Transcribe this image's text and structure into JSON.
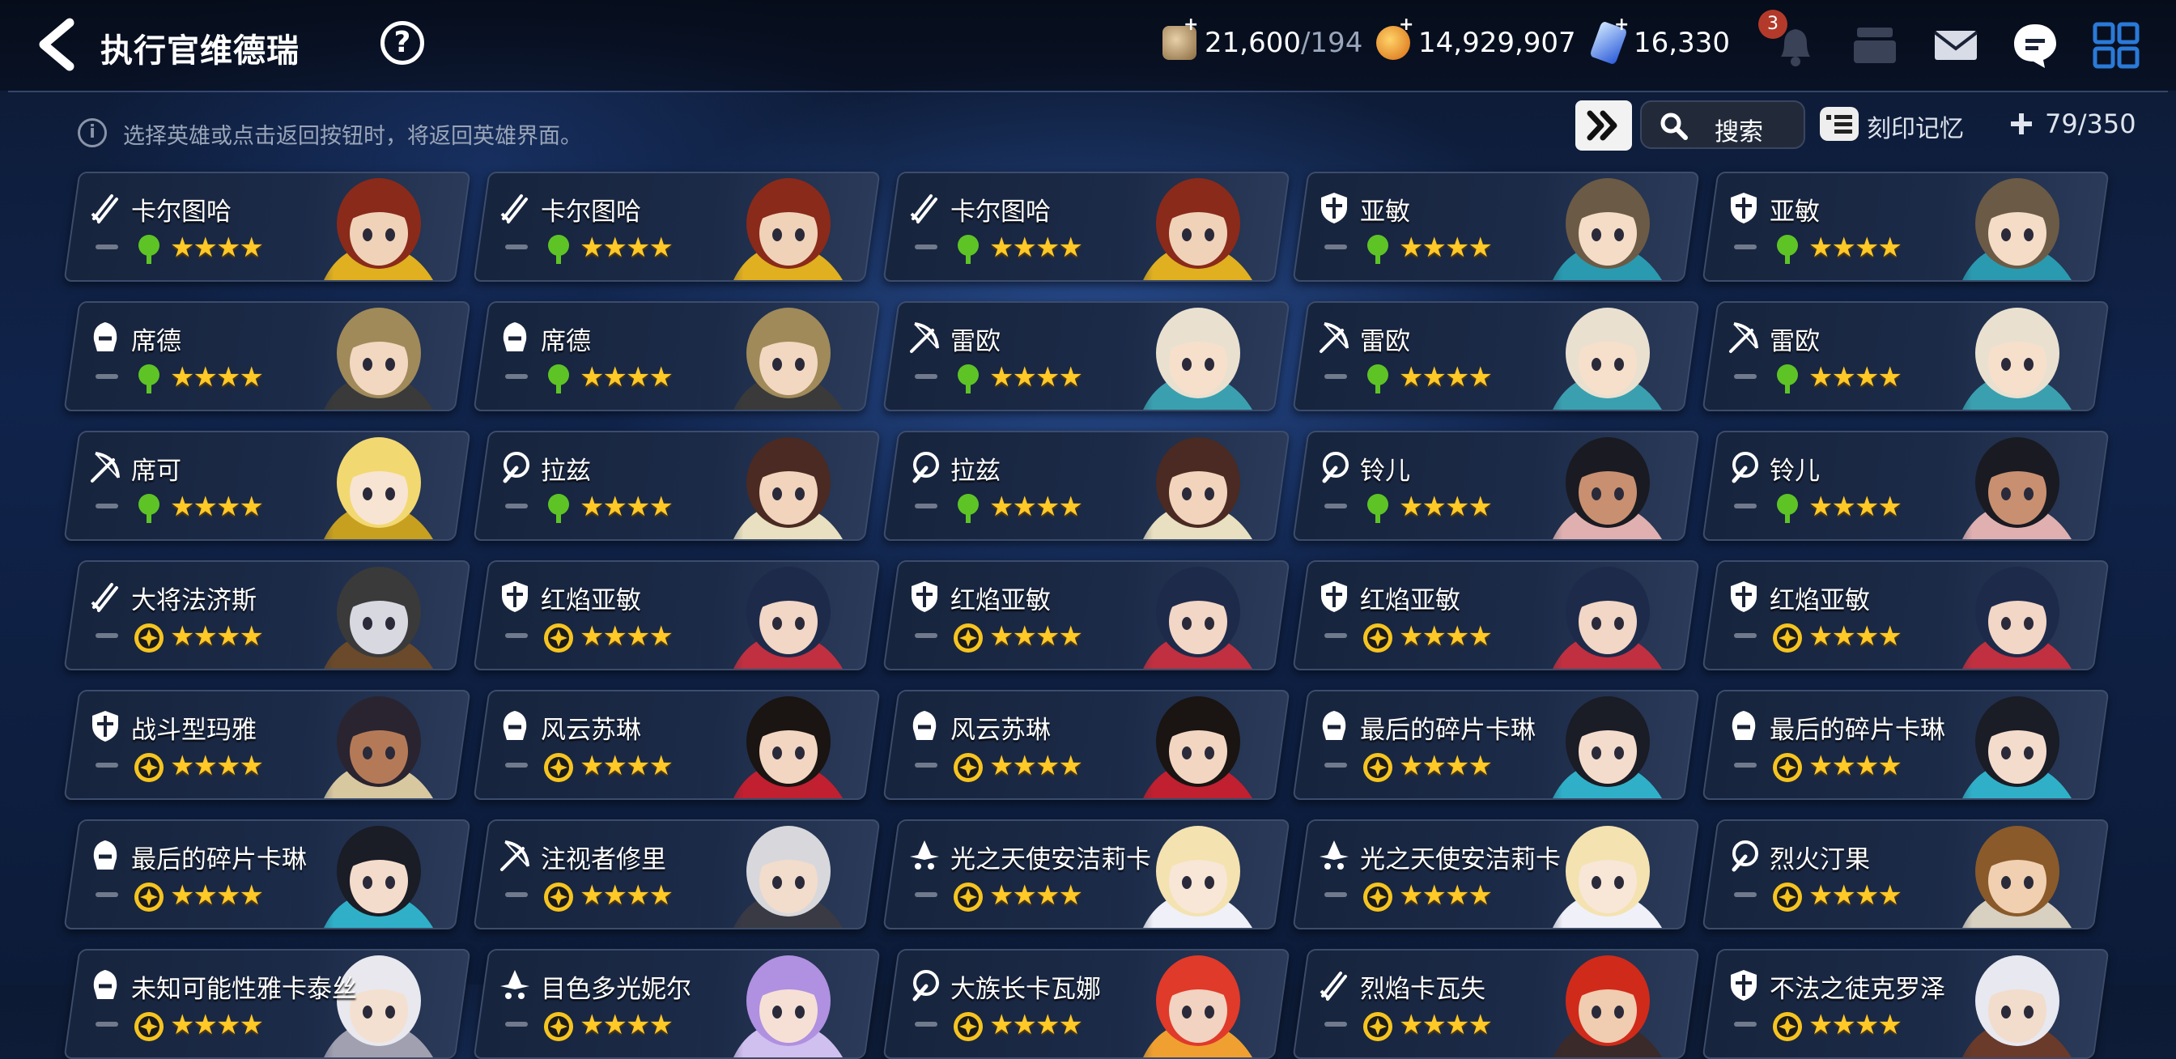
{
  "header": {
    "title": "执行官维德瑞",
    "stamina": "21,600",
    "stamina_cap": "/194",
    "gold": "14,929,907",
    "crystal": "16,330",
    "notification_count": "3"
  },
  "toolbar": {
    "hint": "选择英雄或点击返回按钮时，将返回英雄界面。",
    "search_label": "搜索",
    "imprint_label": "刻印记忆",
    "hero_count": "79/350"
  },
  "heroes": [
    {
      "name": "卡尔图哈",
      "class": "warrior",
      "attr": "earth",
      "stars": 4,
      "hair": "#8a2a1a",
      "skin": "#f0d2b8",
      "accent": "#e0b020"
    },
    {
      "name": "卡尔图哈",
      "class": "warrior",
      "attr": "earth",
      "stars": 4,
      "hair": "#8a2a1a",
      "skin": "#f0d2b8",
      "accent": "#e0b020"
    },
    {
      "name": "卡尔图哈",
      "class": "warrior",
      "attr": "earth",
      "stars": 4,
      "hair": "#8a2a1a",
      "skin": "#f0d2b8",
      "accent": "#e0b020"
    },
    {
      "name": "亚敏",
      "class": "knight",
      "attr": "earth",
      "stars": 4,
      "hair": "#6b5a45",
      "skin": "#f4dcc6",
      "accent": "#2a9ab0"
    },
    {
      "name": "亚敏",
      "class": "knight",
      "attr": "earth",
      "stars": 4,
      "hair": "#6b5a45",
      "skin": "#f4dcc6",
      "accent": "#2a9ab0"
    },
    {
      "name": "席德",
      "class": "thief",
      "attr": "earth",
      "stars": 4,
      "hair": "#a08a5a",
      "skin": "#f2d8c0",
      "accent": "#3a3a3a"
    },
    {
      "name": "席德",
      "class": "thief",
      "attr": "earth",
      "stars": 4,
      "hair": "#a08a5a",
      "skin": "#f2d8c0",
      "accent": "#3a3a3a"
    },
    {
      "name": "雷欧",
      "class": "ranger",
      "attr": "earth",
      "stars": 4,
      "hair": "#eae0d0",
      "skin": "#f6e0cc",
      "accent": "#3aa0b0"
    },
    {
      "name": "雷欧",
      "class": "ranger",
      "attr": "earth",
      "stars": 4,
      "hair": "#eae0d0",
      "skin": "#f6e0cc",
      "accent": "#3aa0b0"
    },
    {
      "name": "雷欧",
      "class": "ranger",
      "attr": "earth",
      "stars": 4,
      "hair": "#eae0d0",
      "skin": "#f6e0cc",
      "accent": "#3aa0b0"
    },
    {
      "name": "席可",
      "class": "ranger",
      "attr": "earth",
      "stars": 4,
      "hair": "#f2d870",
      "skin": "#f8e4d2",
      "accent": "#c8a020"
    },
    {
      "name": "拉兹",
      "class": "mage",
      "attr": "earth",
      "stars": 4,
      "hair": "#4a2a22",
      "skin": "#f2d4bc",
      "accent": "#e8e0c0"
    },
    {
      "name": "拉兹",
      "class": "mage",
      "attr": "earth",
      "stars": 4,
      "hair": "#4a2a22",
      "skin": "#f2d4bc",
      "accent": "#e8e0c0"
    },
    {
      "name": "铃儿",
      "class": "mage",
      "attr": "earth",
      "stars": 4,
      "hair": "#1a1a22",
      "skin": "#c89070",
      "accent": "#e0b0b0"
    },
    {
      "name": "铃儿",
      "class": "mage",
      "attr": "earth",
      "stars": 4,
      "hair": "#1a1a22",
      "skin": "#c89070",
      "accent": "#e0b0b0"
    },
    {
      "name": "大将法济斯",
      "class": "warrior",
      "attr": "light",
      "stars": 4,
      "hair": "#3a3a3a",
      "skin": "#d8d8e0",
      "accent": "#6a4a2a"
    },
    {
      "name": "红焰亚敏",
      "class": "knight",
      "attr": "light",
      "stars": 4,
      "hair": "#1e2a4a",
      "skin": "#f2d6c6",
      "accent": "#c03040"
    },
    {
      "name": "红焰亚敏",
      "class": "knight",
      "attr": "light",
      "stars": 4,
      "hair": "#1e2a4a",
      "skin": "#f2d6c6",
      "accent": "#c03040"
    },
    {
      "name": "红焰亚敏",
      "class": "knight",
      "attr": "light",
      "stars": 4,
      "hair": "#1e2a4a",
      "skin": "#f2d6c6",
      "accent": "#c03040"
    },
    {
      "name": "红焰亚敏",
      "class": "knight",
      "attr": "light",
      "stars": 4,
      "hair": "#1e2a4a",
      "skin": "#f2d6c6",
      "accent": "#c03040"
    },
    {
      "name": "战斗型玛雅",
      "class": "knight",
      "attr": "light",
      "stars": 4,
      "hair": "#2a2430",
      "skin": "#b47a58",
      "accent": "#d8c8a0"
    },
    {
      "name": "风云苏琳",
      "class": "thief",
      "attr": "light",
      "stars": 4,
      "hair": "#1a1412",
      "skin": "#f2d6c2",
      "accent": "#c02030"
    },
    {
      "name": "风云苏琳",
      "class": "thief",
      "attr": "light",
      "stars": 4,
      "hair": "#1a1412",
      "skin": "#f2d6c2",
      "accent": "#c02030"
    },
    {
      "name": "最后的碎片卡琳",
      "class": "thief",
      "attr": "light",
      "stars": 4,
      "hair": "#1a1c26",
      "skin": "#f4dccc",
      "accent": "#30b0c8"
    },
    {
      "name": "最后的碎片卡琳",
      "class": "thief",
      "attr": "light",
      "stars": 4,
      "hair": "#1a1c26",
      "skin": "#f4dccc",
      "accent": "#30b0c8"
    },
    {
      "name": "最后的碎片卡琳",
      "class": "thief",
      "attr": "light",
      "stars": 4,
      "hair": "#1a1c26",
      "skin": "#f4dccc",
      "accent": "#30b0c8"
    },
    {
      "name": "注视者修里",
      "class": "ranger",
      "attr": "light",
      "stars": 4,
      "hair": "#d8d8dc",
      "skin": "#f2dccc",
      "accent": "#3a3a44"
    },
    {
      "name": "光之天使安洁莉卡",
      "class": "soul",
      "attr": "light",
      "stars": 4,
      "hair": "#f4e2b0",
      "skin": "#f8e6d6",
      "accent": "#f0f0f8"
    },
    {
      "name": "光之天使安洁莉卡",
      "class": "soul",
      "attr": "light",
      "stars": 4,
      "hair": "#f4e2b0",
      "skin": "#f8e6d6",
      "accent": "#f0f0f8"
    },
    {
      "name": "烈火汀果",
      "class": "mage",
      "attr": "light",
      "stars": 4,
      "hair": "#8a5a2a",
      "skin": "#f0d0b0",
      "accent": "#d8d0c0"
    },
    {
      "name": "未知可能性雅卡泰丝",
      "class": "thief",
      "attr": "light",
      "stars": 4,
      "hair": "#e8e8ee",
      "skin": "#f4e0d0",
      "accent": "#a0a0b0"
    },
    {
      "name": "目色多光妮尔",
      "class": "soul",
      "attr": "light",
      "stars": 4,
      "hair": "#b090e0",
      "skin": "#f6e0d6",
      "accent": "#d0c0f0"
    },
    {
      "name": "大族长卡瓦娜",
      "class": "mage",
      "attr": "light",
      "stars": 4,
      "hair": "#e03a2a",
      "skin": "#f2d2c0",
      "accent": "#f0a030"
    },
    {
      "name": "烈焰卡瓦失",
      "class": "warrior",
      "attr": "light",
      "stars": 4,
      "hair": "#d02a1a",
      "skin": "#f0ccb0",
      "accent": "#3a2a2a"
    },
    {
      "name": "不法之徒克罗泽",
      "class": "knight",
      "attr": "light",
      "stars": 4,
      "hair": "#e8e8f0",
      "skin": "#f2dccc",
      "accent": "#6a3a2a"
    }
  ]
}
